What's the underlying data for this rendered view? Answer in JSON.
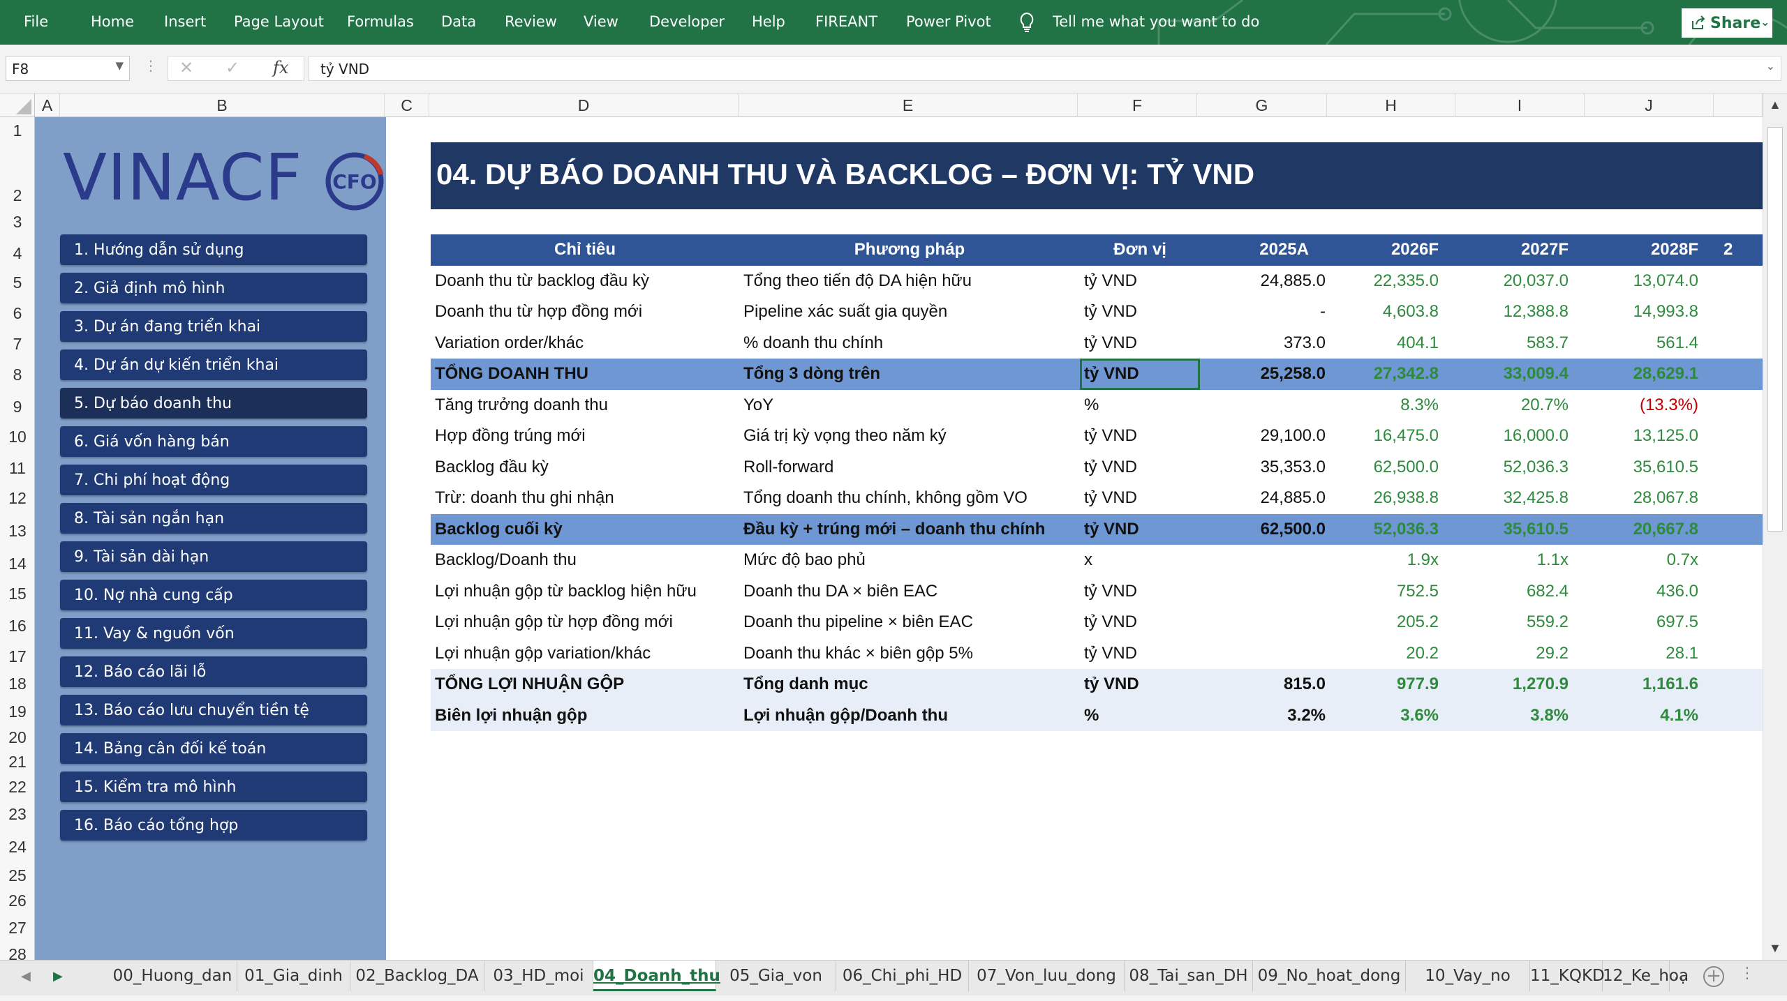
{
  "ribbon": {
    "tabs": [
      "File",
      "Home",
      "Insert",
      "Page Layout",
      "Formulas",
      "Data",
      "Review",
      "View",
      "Developer",
      "Help",
      "FIREANT",
      "Power Pivot"
    ],
    "tell_me": "Tell me what you want to do",
    "share": "Share",
    "color": "#217346"
  },
  "formula_bar": {
    "name_box": "F8",
    "fx": "fx",
    "value": "tỷ VND"
  },
  "columns": [
    "A",
    "B",
    "C",
    "D",
    "E",
    "F",
    "G",
    "H",
    "I",
    "J"
  ],
  "rows": [
    "1",
    "2",
    "3",
    "4",
    "5",
    "6",
    "7",
    "8",
    "9",
    "10",
    "11",
    "12",
    "13",
    "14",
    "15",
    "16",
    "17",
    "18",
    "19",
    "20",
    "21",
    "22",
    "23",
    "24",
    "25",
    "26",
    "27",
    "28"
  ],
  "sidebar": {
    "logo": "VINACF",
    "logo_badge": "CFO",
    "items": [
      "1. Hướng dẫn sử dụng",
      "2. Giả định mô hình",
      "3. Dự án đang triển khai",
      "4. Dự án dự kiến triển khai",
      "5. Dự báo doanh thu",
      "6. Giá vốn hàng bán",
      "7. Chi phí hoạt động",
      "8. Tài sản ngắn hạn",
      "9. Tài sản dài hạn",
      "10. Nợ nhà cung cấp",
      "11. Vay & nguồn vốn",
      "12. Báo cáo lãi lỗ",
      "13. Báo cáo lưu chuyển tiền tệ",
      "14. Bảng cân đối kế toán",
      "15. Kiểm tra mô hình",
      "16. Báo cáo tổng hợp"
    ],
    "active_index": 4
  },
  "sheet": {
    "title": "04. DỰ BÁO DOANH THU VÀ BACKLOG – ĐƠN VỊ: TỶ VND",
    "headers": [
      "Chỉ tiêu",
      "Phương pháp",
      "Đơn vị",
      "2025A",
      "2026F",
      "2027F",
      "2028F",
      "2"
    ],
    "rows": [
      {
        "style": "",
        "cells": [
          "Doanh thu từ backlog đầu kỳ",
          "Tổng theo tiến độ DA hiện hữu",
          "tỷ VND",
          "24,885.0",
          "22,335.0",
          "20,037.0",
          "13,074.0"
        ]
      },
      {
        "style": "",
        "cells": [
          "Doanh thu từ hợp đồng mới",
          "Pipeline xác suất gia quyền",
          "tỷ VND",
          "-",
          "4,603.8",
          "12,388.8",
          "14,993.8"
        ]
      },
      {
        "style": "",
        "cells": [
          "Variation order/khác",
          "% doanh thu chính",
          "tỷ VND",
          "373.0",
          "404.1",
          "583.7",
          "561.4"
        ]
      },
      {
        "style": "hl",
        "cells": [
          "TỔNG DOANH THU",
          "Tổng 3 dòng trên",
          "tỷ VND",
          "25,258.0",
          "27,342.8",
          "33,009.4",
          "28,629.1"
        ]
      },
      {
        "style": "",
        "cells": [
          "Tăng trưởng doanh thu",
          "YoY",
          "%",
          "",
          "8.3%",
          "20.7%",
          "(13.3%)"
        ]
      },
      {
        "style": "",
        "cells": [
          "Hợp đồng trúng mới",
          "Giá trị kỳ vọng theo năm ký",
          "tỷ VND",
          "29,100.0",
          "16,475.0",
          "16,000.0",
          "13,125.0"
        ]
      },
      {
        "style": "",
        "cells": [
          "Backlog đầu kỳ",
          "Roll-forward",
          "tỷ VND",
          "35,353.0",
          "62,500.0",
          "52,036.3",
          "35,610.5"
        ]
      },
      {
        "style": "",
        "cells": [
          "Trừ: doanh thu ghi nhận",
          "Tổng doanh thu chính, không gồm VO",
          "tỷ VND",
          "24,885.0",
          "26,938.8",
          "32,425.8",
          "28,067.8"
        ]
      },
      {
        "style": "hl",
        "cells": [
          "Backlog cuối kỳ",
          "Đầu kỳ + trúng mới – doanh thu chính",
          "tỷ VND",
          "62,500.0",
          "52,036.3",
          "35,610.5",
          "20,667.8"
        ]
      },
      {
        "style": "",
        "cells": [
          "Backlog/Doanh thu",
          "Mức độ bao phủ",
          "x",
          "",
          "1.9x",
          "1.1x",
          "0.7x"
        ]
      },
      {
        "style": "",
        "cells": [
          "Lợi nhuận gộp từ backlog hiện hữu",
          "Doanh thu DA × biên EAC",
          "tỷ VND",
          "",
          "752.5",
          "682.4",
          "436.0"
        ]
      },
      {
        "style": "",
        "cells": [
          "Lợi nhuận gộp từ hợp đồng mới",
          "Doanh thu pipeline × biên EAC",
          "tỷ VND",
          "",
          "205.2",
          "559.2",
          "697.5"
        ]
      },
      {
        "style": "",
        "cells": [
          "Lợi nhuận gộp variation/khác",
          "Doanh thu khác × biên gộp 5%",
          "tỷ VND",
          "",
          "20.2",
          "29.2",
          "28.1"
        ]
      },
      {
        "style": "tot",
        "cells": [
          "TỔNG LỢI NHUẬN GỘP",
          "Tổng danh mục",
          "tỷ VND",
          "815.0",
          "977.9",
          "1,270.9",
          "1,161.6"
        ]
      },
      {
        "style": "tot",
        "cells": [
          "Biên lợi nhuận gộp",
          "Lợi nhuận gộp/Doanh thu",
          "%",
          "3.2%",
          "3.6%",
          "3.8%",
          "4.1%"
        ]
      }
    ]
  },
  "sheet_tabs": [
    "00_Huong_dan",
    "01_Gia_dinh",
    "02_Backlog_DA",
    "03_HD_moi",
    "04_Doanh_thu",
    "05_Gia_von",
    "06_Chi_phi_HD",
    "07_Von_luu_dong",
    "08_Tai_san_DH",
    "09_No_hoat_dong",
    "10_Vay_no",
    "11_KQKD",
    "12_Ke_hoạ"
  ],
  "active_tab_index": 4,
  "tab_more": "...",
  "colors": {
    "title_bg": "#1f3864",
    "header_bg": "#2f5597",
    "highlight_row": "#6f97d3",
    "sidebar_bg": "#7f9ec8",
    "nav_button": "#1f3a74",
    "forecast_green": "#2e8b3d",
    "negative_red": "#c00000"
  }
}
